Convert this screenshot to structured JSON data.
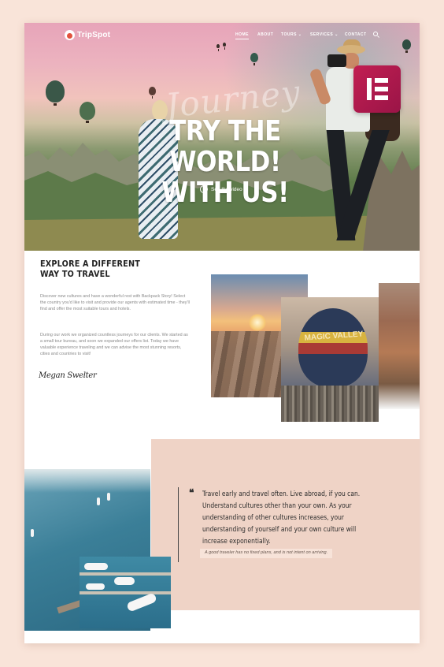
{
  "brand": {
    "name": "TripSpot"
  },
  "nav": {
    "items": [
      "HOME",
      "ABOUT",
      "TOURS ⌄",
      "SERVICES ⌄",
      "CONTACT"
    ],
    "active": "HOME"
  },
  "hero": {
    "script_word": "Journey",
    "title_line1": "TRY THE WORLD!",
    "title_line2": "WITH US!",
    "video_label": "See the video"
  },
  "about": {
    "title_line1": "EXPLORE A DIFFERENT",
    "title_line2": "WAY TO TRAVEL",
    "paragraph1": "Discover new cultures and have a wonderful rest with Backpack Story! Select the country you'd like to visit and provide our agents with estimated time - they'll find and offer the most suitable tours and hotels.",
    "paragraph2": "During our work we organized countless journeys for our clients. We started as a small tour bureau, and soon we expanded our offers list. Today we have valuable experience traveling and we can advise the most stunning resorts, cities and countries to visit!",
    "signature": "Megan Swelter",
    "balloon_text": "MAGIC VALLEY"
  },
  "quote": {
    "mark": "❝",
    "text": "Travel early and travel often. Live abroad, if you can. Understand cultures other than your own. As your understanding of other cultures increases, your understanding of yourself and your own culture will increase exponentially.",
    "caption": "A good traveler has no fixed plans, and is not intent on arriving."
  },
  "colors": {
    "background": "#f9e4d9",
    "accent": "#e1533e",
    "quote_panel": "#efd3c6",
    "elementor": "#c21f52"
  },
  "icons": [
    "logo-icon",
    "search-icon",
    "play-icon",
    "elementor-icon",
    "quote-icon"
  ]
}
